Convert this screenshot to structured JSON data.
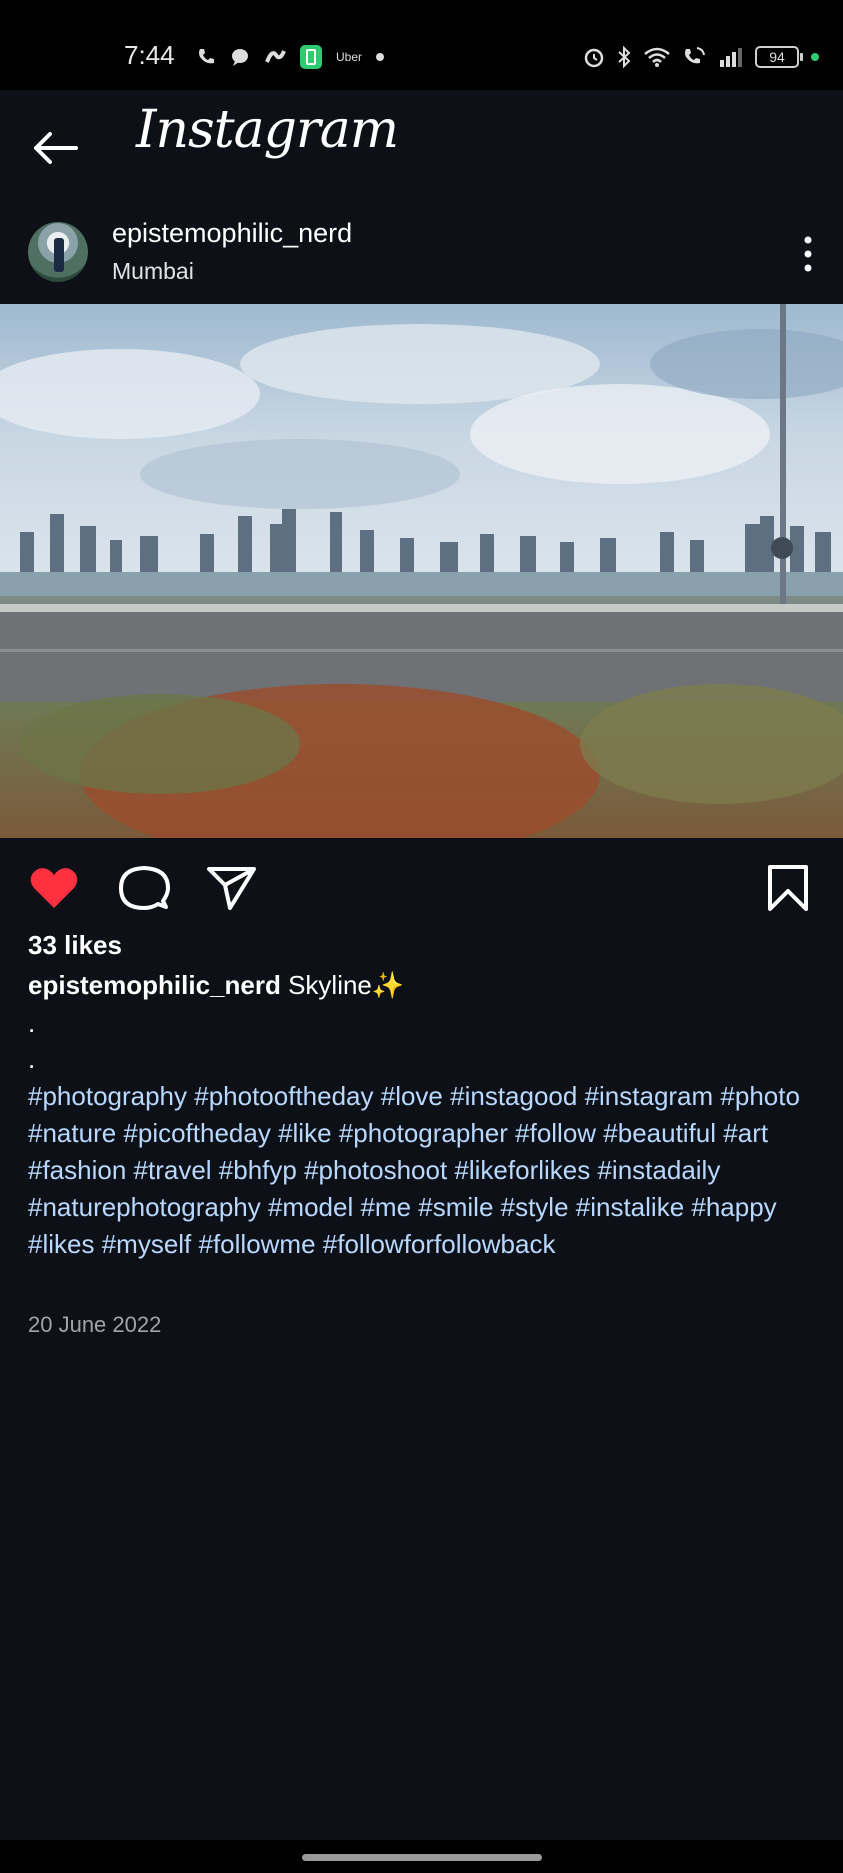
{
  "status_bar": {
    "time": "7:44",
    "uber_label": "Uber",
    "battery": "94"
  },
  "app_bar": {
    "title": "Instagram",
    "back_icon": "arrow-left-icon"
  },
  "post": {
    "username": "epistemophilic_nerd",
    "location": "Mumbai",
    "image_alt": "Mumbai skyline seen from a moving car along the sea face",
    "liked": true,
    "likes_text": "33 likes",
    "caption_user": "epistemophilic_nerd",
    "caption_text": "Skyline✨",
    "dot_1": ".",
    "dot_2": ".",
    "hashtags": "#photography #photooftheday #love #instagood #instagram #photo #nature #picoftheday #like #photographer #follow #beautiful #art #fashion #travel #bhfyp #photoshoot #likeforlikes #instadaily #naturephotography #model #me #smile #style #instalike #happy #likes #myself #followme #followforfollowback",
    "date": "20 June 2022"
  },
  "colors": {
    "background": "#0d1117",
    "like_red": "#ff3040",
    "hashtag_blue": "#b8d8ff",
    "meta_gray": "#a0a4a8"
  }
}
